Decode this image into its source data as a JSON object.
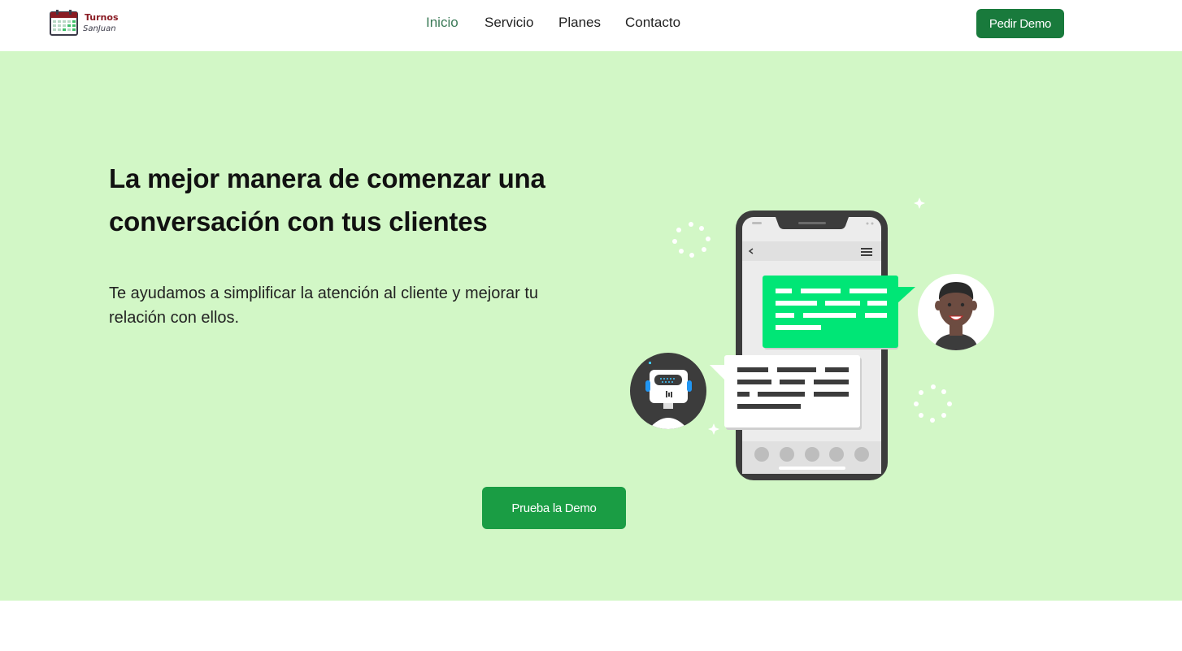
{
  "brand": {
    "name_line1": "Turnos",
    "name_line2": "SanJuan"
  },
  "nav": {
    "items": [
      {
        "label": "Inicio",
        "active": true
      },
      {
        "label": "Servicio"
      },
      {
        "label": "Planes"
      },
      {
        "label": "Contacto"
      }
    ],
    "cta_label": "Pedir Demo"
  },
  "hero": {
    "title": "La mejor manera de comenzar una conversación con tus clientes",
    "subtitle": "Te ayudamos a simplificar la atención al cliente y mejorar tu relación con ellos.",
    "cta_label": "Prueba la Demo",
    "illustration": {
      "icons": [
        "smartphone-icon",
        "chat-bubble-icon",
        "robot-avatar-icon",
        "user-avatar-icon"
      ]
    }
  },
  "colors": {
    "hero_bg": "#d2f7c6",
    "primary_button": "#197a3c",
    "demo_button": "#1a9d44",
    "nav_active": "#3b7a57",
    "chat_green": "#00e676",
    "brand_red": "#8a1c24"
  }
}
